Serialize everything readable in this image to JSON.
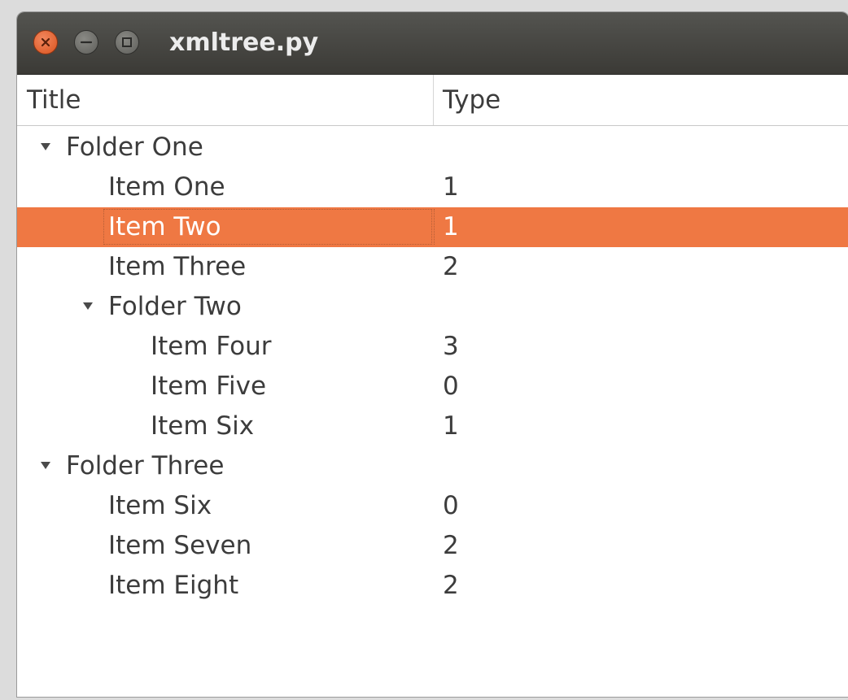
{
  "window": {
    "title": "xmltree.py"
  },
  "columns": {
    "title": "Title",
    "type": "Type"
  },
  "rows": [
    {
      "label": "Folder One",
      "value": "",
      "kind": "folder",
      "depth": 0
    },
    {
      "label": "Item One",
      "value": "1",
      "kind": "item",
      "depth": 1
    },
    {
      "label": "Item Two",
      "value": "1",
      "kind": "item",
      "depth": 1,
      "selected": true
    },
    {
      "label": "Item Three",
      "value": "2",
      "kind": "item",
      "depth": 1
    },
    {
      "label": "Folder Two",
      "value": "",
      "kind": "folder",
      "depth": 1
    },
    {
      "label": "Item Four",
      "value": "3",
      "kind": "item",
      "depth": 2
    },
    {
      "label": "Item Five",
      "value": "0",
      "kind": "item",
      "depth": 2
    },
    {
      "label": "Item Six",
      "value": "1",
      "kind": "item",
      "depth": 2
    },
    {
      "label": "Folder Three",
      "value": "",
      "kind": "folder",
      "depth": 0
    },
    {
      "label": "Item Six",
      "value": "0",
      "kind": "item",
      "depth": 1
    },
    {
      "label": "Item Seven",
      "value": "2",
      "kind": "item",
      "depth": 1
    },
    {
      "label": "Item Eight",
      "value": "2",
      "kind": "item",
      "depth": 1
    }
  ],
  "colors": {
    "selection": "#ef7843",
    "titlebar": "#3b3a36",
    "close_button": "#e0591f"
  },
  "icons": {
    "expander": "triangle-down-icon",
    "close": "close-icon",
    "minimize": "minimize-icon",
    "maximize": "maximize-icon"
  }
}
